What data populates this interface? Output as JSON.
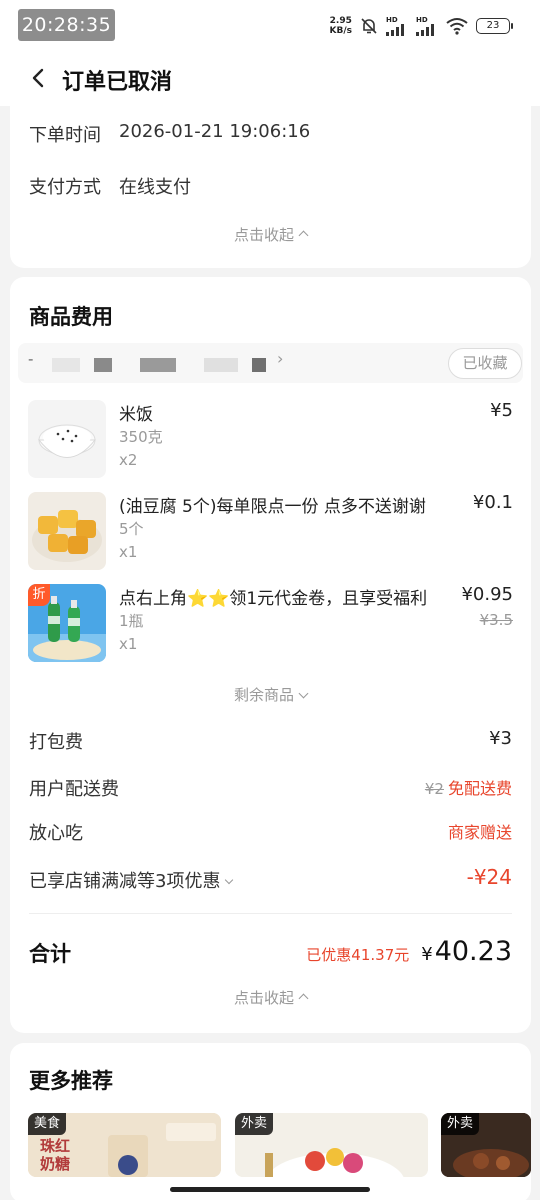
{
  "status_bar": {
    "time": "20:28:35",
    "net_speed_value": "2.95",
    "net_speed_unit": "KB/s",
    "hd1": "HD",
    "hd2": "HD",
    "battery": "23"
  },
  "nav": {
    "title": "订单已取消"
  },
  "order_info": {
    "time_label": "下单时间",
    "time_value": "2026-01-21 19:06:16",
    "payment_label": "支付方式",
    "payment_value": "在线支付",
    "collapse_label": "点击收起"
  },
  "goods": {
    "title": "商品费用",
    "shop_prefix": "-",
    "shop_chevron": "›",
    "favorite_label": "已收藏",
    "items": [
      {
        "name": "米饭",
        "spec": "350克",
        "qty": "x2",
        "price": "¥5",
        "orig_price": ""
      },
      {
        "name": "(油豆腐 5个)每单限点一份  点多不送谢谢",
        "spec": "5个",
        "qty": "x1",
        "price": "¥0.1",
        "orig_price": ""
      },
      {
        "name": "点右上角⭐⭐领1元代金卷，且享受福利",
        "spec": "1瓶",
        "qty": "x1",
        "price": "¥0.95",
        "orig_price": "¥3.5",
        "tag": "折"
      }
    ],
    "more_label": "剩余商品",
    "fees": {
      "packing_label": "打包费",
      "packing_value": "¥3",
      "delivery_label": "用户配送费",
      "delivery_orig": "¥2",
      "delivery_value": "免配送费",
      "safe_label": "放心吃",
      "safe_value": "商家赠送",
      "promo_label": "已享店铺满减等3项优惠",
      "promo_value": "-¥24"
    },
    "total": {
      "label": "合计",
      "saved": "已优惠41.37元",
      "currency": "¥",
      "amount": "40.23"
    },
    "collapse_label": "点击收起"
  },
  "recommend": {
    "title": "更多推荐",
    "cards": [
      {
        "tag": "美食",
        "text": "珠红奶糖"
      },
      {
        "tag": "外卖"
      },
      {
        "tag": "外卖"
      }
    ]
  },
  "colors": {
    "accent_red": "#e8452c",
    "background": "#f3f3f3"
  }
}
